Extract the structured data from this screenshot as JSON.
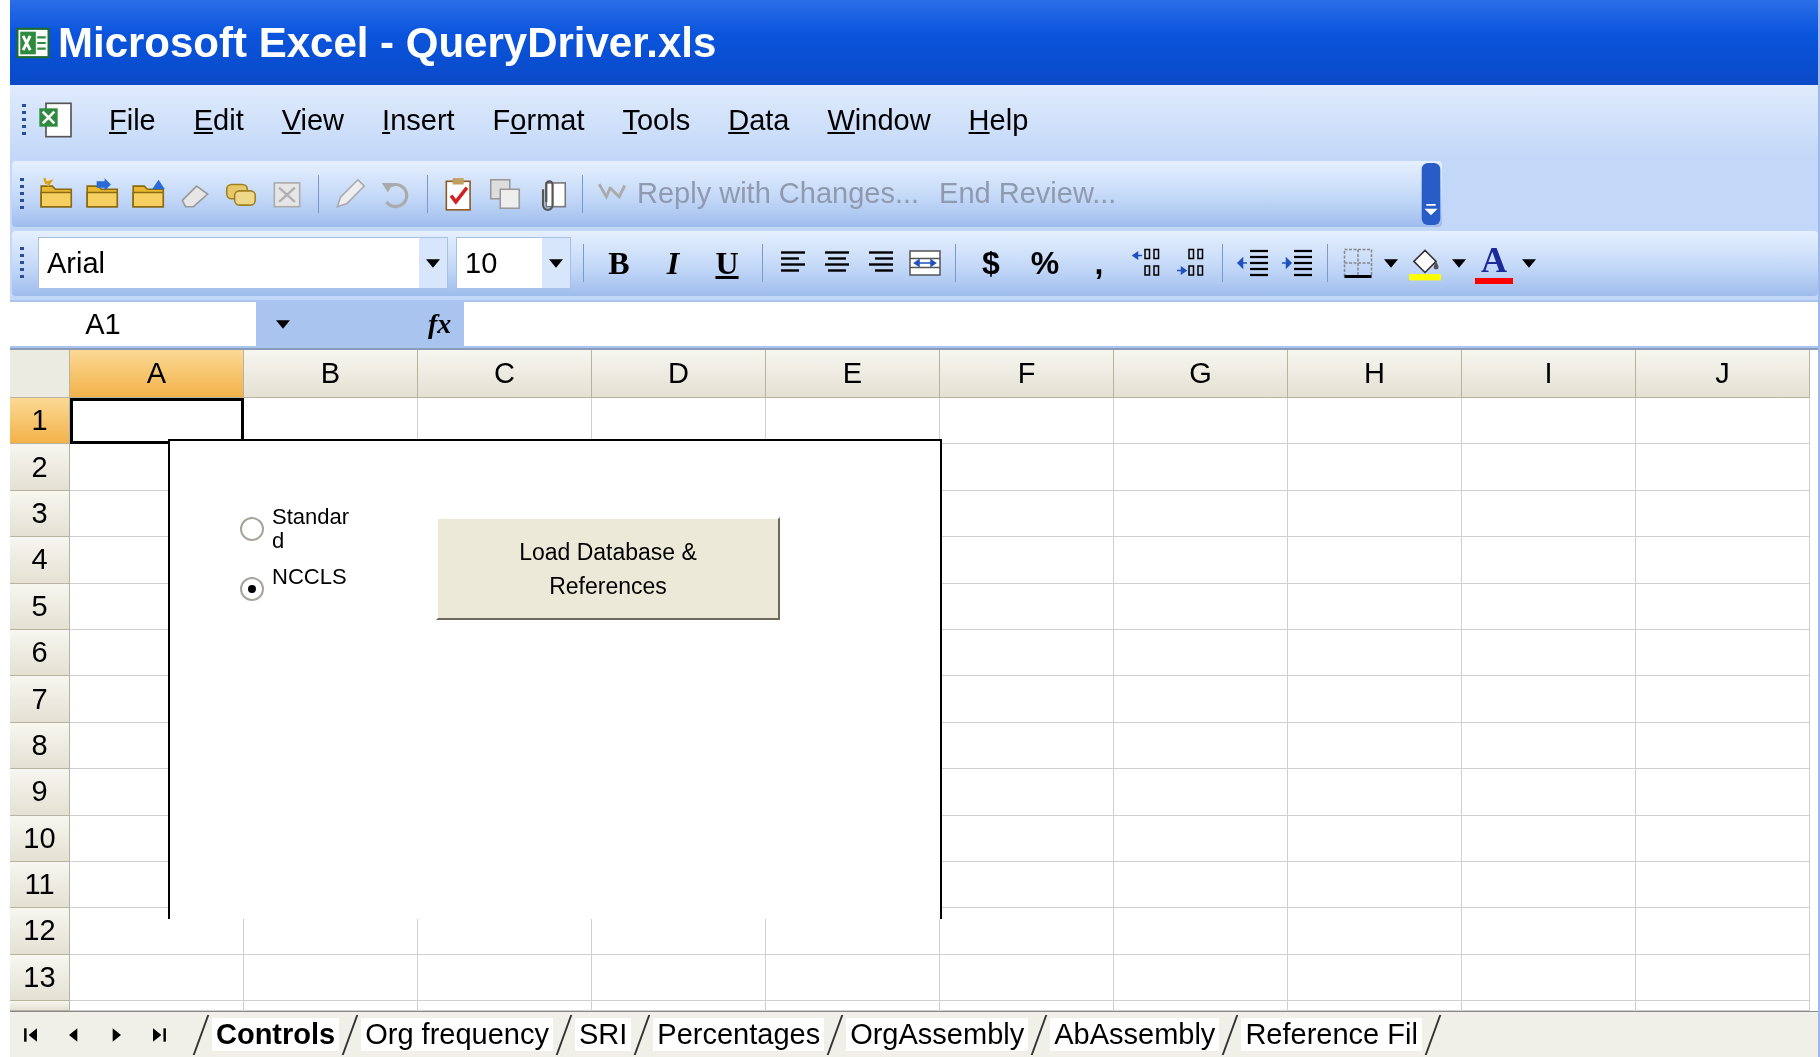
{
  "window": {
    "title": "Microsoft Excel - QueryDriver.xls"
  },
  "menu": [
    {
      "label": "File"
    },
    {
      "label": "Edit"
    },
    {
      "label": "View"
    },
    {
      "label": "Insert"
    },
    {
      "label": "Format"
    },
    {
      "label": "Tools"
    },
    {
      "label": "Data"
    },
    {
      "label": "Window"
    },
    {
      "label": "Help"
    }
  ],
  "review_toolbar": [
    {
      "label": "Reply with Changes...",
      "disabled": true
    },
    {
      "label": "End Review...",
      "disabled": true
    }
  ],
  "formatting_toolbar": {
    "font": "Arial",
    "size": "10",
    "bold": "B",
    "italic": "I",
    "underline": "U",
    "currency": "$",
    "percent": "%",
    "comma": ",",
    "font_color": "A"
  },
  "formula_bar": {
    "name_box": "A1",
    "function_label": "fx"
  },
  "sheet": {
    "columns": [
      {
        "label": "A",
        "selected": true
      },
      {
        "label": "B",
        "selected": false
      },
      {
        "label": "C",
        "selected": false
      },
      {
        "label": "D",
        "selected": false
      },
      {
        "label": "E",
        "selected": false
      },
      {
        "label": "F",
        "selected": false
      },
      {
        "label": "G",
        "selected": false
      },
      {
        "label": "H",
        "selected": false
      },
      {
        "label": "I",
        "selected": false
      },
      {
        "label": "J",
        "selected": false
      }
    ],
    "rows": [
      {
        "label": "1",
        "selected": true
      },
      {
        "label": "2",
        "selected": false
      },
      {
        "label": "3",
        "selected": false
      },
      {
        "label": "4",
        "selected": false
      },
      {
        "label": "5",
        "selected": false
      },
      {
        "label": "6",
        "selected": false
      },
      {
        "label": "7",
        "selected": false
      },
      {
        "label": "8",
        "selected": false
      },
      {
        "label": "9",
        "selected": false
      },
      {
        "label": "10",
        "selected": false
      },
      {
        "label": "11",
        "selected": false
      },
      {
        "label": "12",
        "selected": false
      },
      {
        "label": "13",
        "selected": false
      }
    ]
  },
  "form": {
    "options": [
      {
        "label": "Standard",
        "selected": false
      },
      {
        "label": "NCCLS",
        "selected": true
      }
    ],
    "button": "Load Database & References"
  },
  "sheet_tabs": [
    {
      "label": "Controls",
      "selected": true
    },
    {
      "label": "Org frequency",
      "selected": false
    },
    {
      "label": "SRI",
      "selected": false
    },
    {
      "label": "Percentages",
      "selected": false
    },
    {
      "label": "OrgAssembly",
      "selected": false
    },
    {
      "label": "AbAssembly",
      "selected": false
    },
    {
      "label": "Reference Fil",
      "selected": false
    }
  ]
}
